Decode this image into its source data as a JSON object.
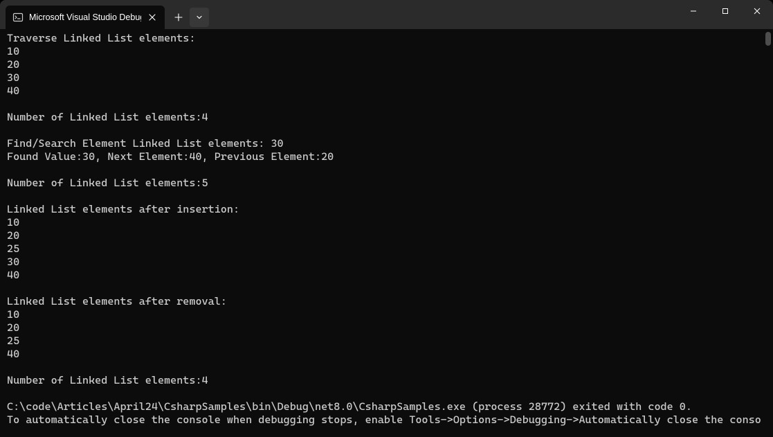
{
  "window": {
    "tab_title": "Microsoft Visual Studio Debug"
  },
  "console": {
    "lines": [
      "Traverse Linked List elements:",
      "10",
      "20",
      "30",
      "40",
      "",
      "Number of Linked List elements:4",
      "",
      "Find/Search Element Linked List elements: 30",
      "Found Value:30, Next Element:40, Previous Element:20",
      "",
      "Number of Linked List elements:5",
      "",
      "Linked List elements after insertion:",
      "10",
      "20",
      "25",
      "30",
      "40",
      "",
      "Linked List elements after removal:",
      "10",
      "20",
      "25",
      "40",
      "",
      "Number of Linked List elements:4",
      "",
      "C:\\code\\Articles\\April24\\CsharpSamples\\bin\\Debug\\net8.0\\CsharpSamples.exe (process 28772) exited with code 0.",
      "To automatically close the console when debugging stops, enable Tools->Options->Debugging->Automatically close the conso"
    ]
  }
}
